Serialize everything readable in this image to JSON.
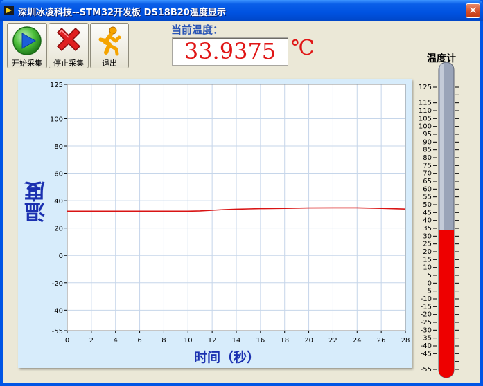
{
  "window": {
    "title": "深圳冰凌科技--STM32开发板 DS18B20温度显示",
    "close_glyph": "✕"
  },
  "toolbar": {
    "start_label": "开始采集",
    "stop_label": "停止采集",
    "exit_label": "退出"
  },
  "reading": {
    "label": "当前温度：",
    "value": "33.9375",
    "unit": "℃"
  },
  "colors": {
    "plot_bg": "#ffffff",
    "grid": "#c6d6ea",
    "trace": "#d91414",
    "thermo_fill": "#ee0000",
    "thermo_tube": "#9aa4b8"
  },
  "chart_data": [
    {
      "type": "line",
      "xlabel": "时间（秒）",
      "ylabel": "温度",
      "xlim": [
        0,
        28
      ],
      "ylim": [
        -55,
        125
      ],
      "x_ticks": [
        0,
        2,
        4,
        6,
        8,
        10,
        12,
        14,
        16,
        18,
        20,
        22,
        24,
        26,
        28
      ],
      "y_ticks": [
        125,
        100,
        80,
        60,
        40,
        20,
        0,
        -20,
        -40,
        -55
      ],
      "grid": true,
      "series": [
        {
          "x": [
            0,
            2,
            4,
            6,
            8,
            10,
            11,
            12,
            13,
            14,
            15,
            16,
            18,
            20,
            22,
            24,
            26,
            28
          ],
          "values": [
            32.3,
            32.3,
            32.3,
            32.3,
            32.3,
            32.3,
            32.5,
            33.0,
            33.5,
            33.8,
            34.0,
            34.2,
            34.4,
            34.7,
            34.8,
            34.8,
            34.4,
            33.9
          ]
        }
      ]
    },
    {
      "type": "bar",
      "title": "温度计",
      "ylim": [
        -55,
        125
      ],
      "y_ticks": [
        125,
        115,
        110,
        105,
        100,
        95,
        90,
        85,
        80,
        75,
        70,
        65,
        60,
        55,
        50,
        45,
        40,
        35,
        30,
        25,
        20,
        15,
        10,
        5,
        0,
        -5,
        -10,
        -15,
        -20,
        -25,
        -30,
        -35,
        -40,
        -45,
        -55
      ],
      "value": 33.9375
    }
  ]
}
